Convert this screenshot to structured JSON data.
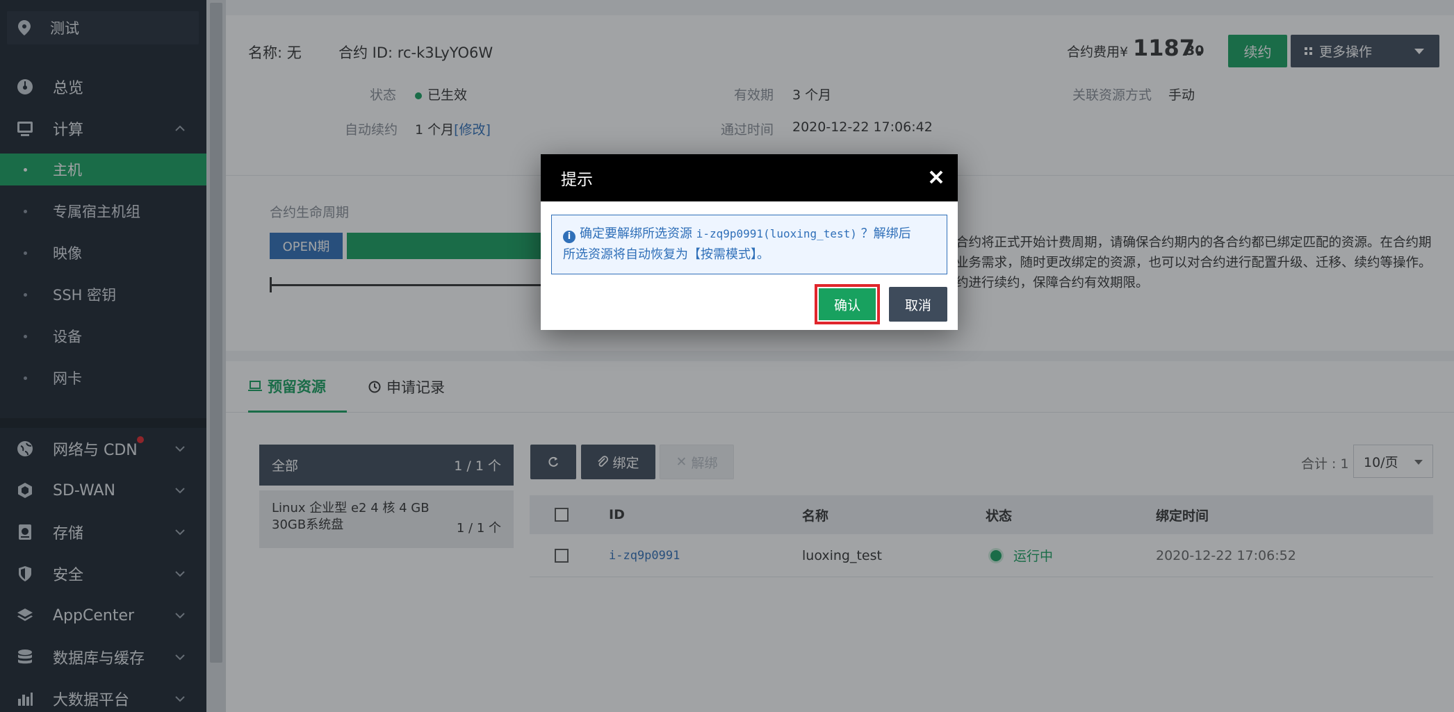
{
  "sidebar": {
    "search_text": "测试",
    "items": [
      {
        "label": "总览"
      },
      {
        "label": "计算"
      },
      {
        "label": "网络与 CDN"
      },
      {
        "label": "SD-WAN"
      },
      {
        "label": "存储"
      },
      {
        "label": "安全"
      },
      {
        "label": "AppCenter"
      },
      {
        "label": "数据库与缓存"
      },
      {
        "label": "大数据平台"
      }
    ],
    "sub_items": [
      {
        "label": "主机"
      },
      {
        "label": "专属宿主机组"
      },
      {
        "label": "映像"
      },
      {
        "label": "SSH 密钥"
      },
      {
        "label": "设备"
      },
      {
        "label": "网卡"
      }
    ]
  },
  "contract": {
    "name_label": "名称: 无",
    "id_label": "合约 ID: rc-k3LyYO6W",
    "status_key": "状态",
    "status_value": "已生效",
    "validity_key": "有效期",
    "validity_value": "3 个月",
    "link_mode_key": "关联资源方式",
    "link_mode_value": "手动",
    "auto_renew_key": "自动续约",
    "auto_renew_value": "1 个月",
    "modify_link": "[修改]",
    "approved_key": "通过时间",
    "approved_value": "2020-12-22 17:06:42",
    "fee_label": "合约费用¥",
    "fee_int": "1187.",
    "fee_dec": "30",
    "renew_button": "续约",
    "more_button": "更多操作",
    "accent_color": "#18a15f"
  },
  "lifecycle": {
    "title": "合约生命周期",
    "open_tag": "OPEN期",
    "desc_line1": "合约将正式开始计费周期，请确保合约期内的各合约都已绑定匹配的资源。在合约期",
    "desc_line2": "业务需求，随时更改绑定的资源，也可以对合约进行配置升级、迁移、续约等操作。",
    "desc_line3": "约进行续约，保障合约有效期限。"
  },
  "tabs": [
    {
      "label": "预留资源"
    },
    {
      "label": "申请记录"
    }
  ],
  "filters": {
    "all_label": "全部",
    "all_count": "1 / 1 个",
    "item_line1": "Linux  企业型 e2  4 核  4 GB",
    "item_line2": "30GB系统盘",
    "item_count": "1 / 1 个"
  },
  "toolbar": {
    "bind_label": "绑定",
    "unbind_label": "解绑",
    "total_label": "合计 : 1",
    "page_size": "10/页"
  },
  "table": {
    "headers": {
      "id": "ID",
      "name": "名称",
      "status": "状态",
      "bind_time": "绑定时间"
    },
    "rows": [
      {
        "id": "i-zq9p0991",
        "name": "luoxing_test",
        "status": "运行中",
        "bind_time": "2020-12-22 17:06:52"
      }
    ]
  },
  "dialog": {
    "title": "提示",
    "msg_prefix": "确定要解绑所选资源",
    "msg_resource": "i-zq9p0991(luoxing_test)",
    "msg_suffix": "？解绑后",
    "msg_line2": "所选资源将自动恢复为【按需模式】。",
    "ok_label": "确认",
    "cancel_label": "取消"
  }
}
